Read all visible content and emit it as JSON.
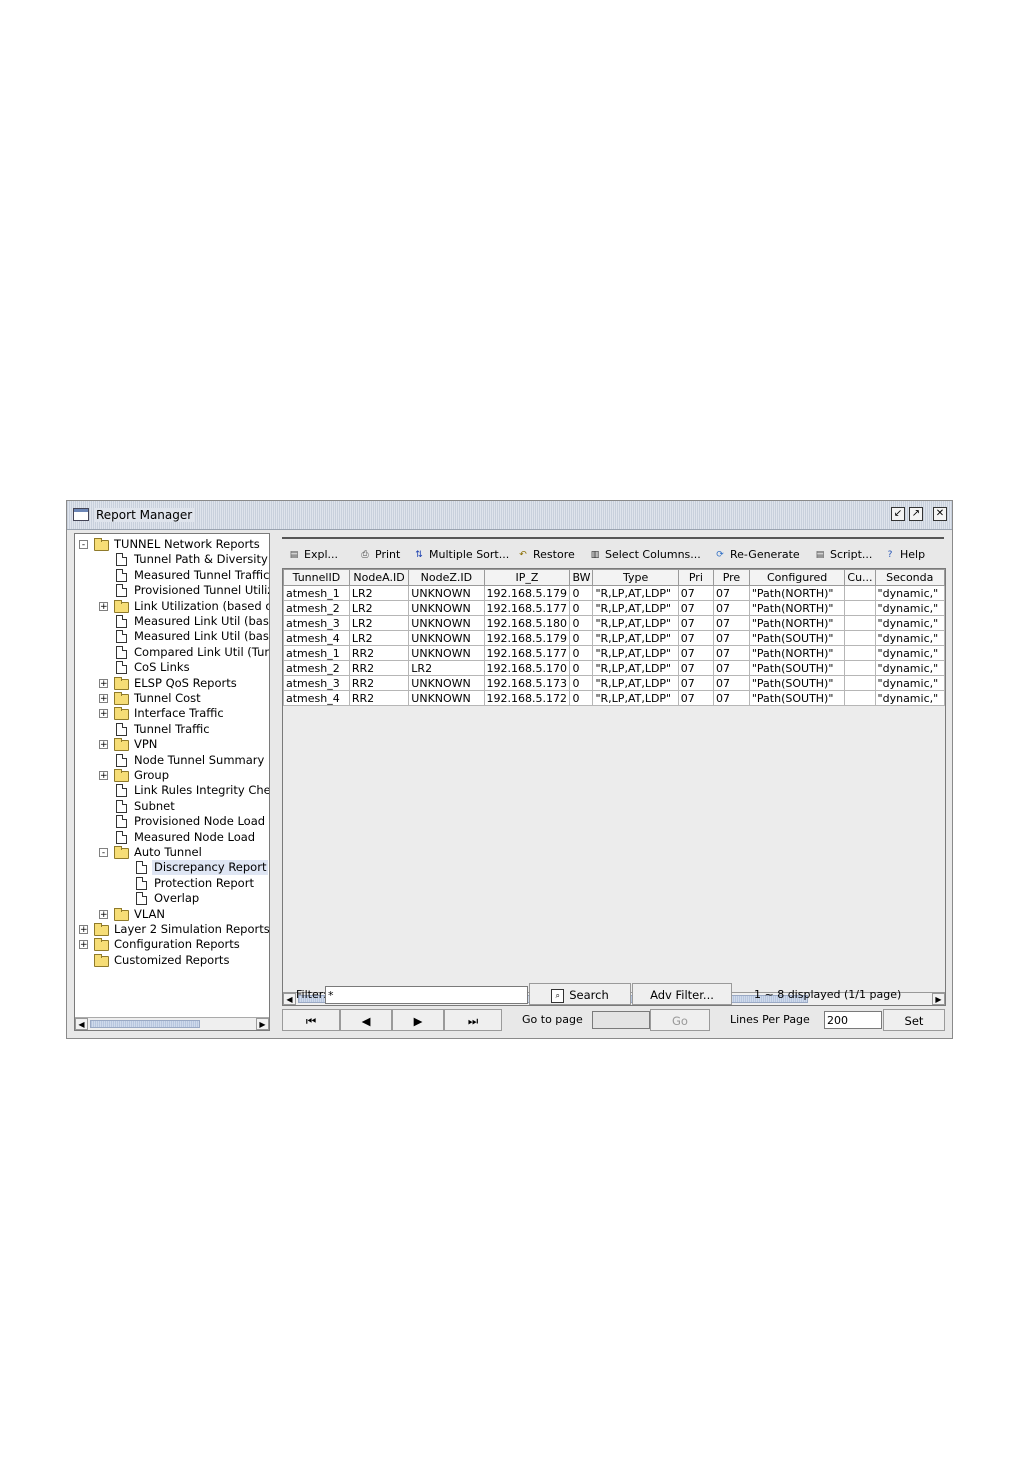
{
  "window": {
    "title": "Report Manager"
  },
  "tree": [
    {
      "label": "TUNNEL Network Reports",
      "type": "folder",
      "level": 0,
      "toggle": "-"
    },
    {
      "label": "Tunnel Path & Diversity",
      "type": "doc",
      "level": 1
    },
    {
      "label": "Measured Tunnel Traffic",
      "type": "doc",
      "level": 1
    },
    {
      "label": "Provisioned Tunnel Utiliza",
      "type": "doc",
      "level": 1
    },
    {
      "label": "Link Utilization (based on",
      "type": "folder",
      "level": 1,
      "toggle": "+"
    },
    {
      "label": "Measured Link Util (based",
      "type": "doc",
      "level": 1
    },
    {
      "label": "Measured Link Util (based",
      "type": "doc",
      "level": 1
    },
    {
      "label": "Compared Link Util (Tunn",
      "type": "doc",
      "level": 1
    },
    {
      "label": "CoS Links",
      "type": "doc",
      "level": 1
    },
    {
      "label": "ELSP QoS Reports",
      "type": "folder",
      "level": 1,
      "toggle": "+"
    },
    {
      "label": "Tunnel Cost",
      "type": "folder",
      "level": 1,
      "toggle": "+"
    },
    {
      "label": "Interface Traffic",
      "type": "folder",
      "level": 1,
      "toggle": "+"
    },
    {
      "label": "Tunnel Traffic",
      "type": "doc",
      "level": 1
    },
    {
      "label": "VPN",
      "type": "folder",
      "level": 1,
      "toggle": "+"
    },
    {
      "label": "Node Tunnel Summary",
      "type": "doc",
      "level": 1
    },
    {
      "label": "Group",
      "type": "folder",
      "level": 1,
      "toggle": "+"
    },
    {
      "label": "Link Rules Integrity Check",
      "type": "doc",
      "level": 1
    },
    {
      "label": "Subnet",
      "type": "doc",
      "level": 1
    },
    {
      "label": "Provisioned Node Load",
      "type": "doc",
      "level": 1
    },
    {
      "label": "Measured Node Load",
      "type": "doc",
      "level": 1
    },
    {
      "label": "Auto Tunnel",
      "type": "folder",
      "level": 1,
      "toggle": "-"
    },
    {
      "label": "Discrepancy Report",
      "type": "doc",
      "level": 2,
      "selected": true
    },
    {
      "label": "Protection Report",
      "type": "doc",
      "level": 2
    },
    {
      "label": "Overlap",
      "type": "doc",
      "level": 2
    },
    {
      "label": "VLAN",
      "type": "folder",
      "level": 1,
      "toggle": "+"
    },
    {
      "label": "Layer 2 Simulation Reports",
      "type": "folder",
      "level": 0,
      "toggle": "+"
    },
    {
      "label": "Configuration Reports",
      "type": "folder",
      "level": 0,
      "toggle": "+"
    },
    {
      "label": "Customized Reports",
      "type": "folder",
      "level": 0
    }
  ],
  "toolbar": [
    {
      "label": "Expl...",
      "icon": "document-icon",
      "glyph": "▤",
      "color": "#444444"
    },
    {
      "label": "Print",
      "icon": "printer-icon",
      "glyph": "⎙",
      "color": "#444444"
    },
    {
      "label": "Multiple Sort...",
      "icon": "sort-icon",
      "glyph": "⇅",
      "color": "#1a3fb0"
    },
    {
      "label": "Restore",
      "icon": "restore-icon",
      "glyph": "↶",
      "color": "#8a6d00"
    },
    {
      "label": "Select Columns...",
      "icon": "columns-icon",
      "glyph": "▥",
      "color": "#222222"
    },
    {
      "label": "Re-Generate",
      "icon": "refresh-icon",
      "glyph": "⟳",
      "color": "#2b6cc4"
    },
    {
      "label": "Script...",
      "icon": "script-icon",
      "glyph": "▤",
      "color": "#444444"
    },
    {
      "label": "Help",
      "icon": "help-icon",
      "glyph": "?",
      "color": "#2152b5"
    }
  ],
  "table": {
    "columns": [
      "TunnelID",
      "NodeA.ID",
      "NodeZ.ID",
      "IP_Z",
      "BW",
      "Type",
      "Pri",
      "Pre",
      "Configured",
      "Cu...",
      "Seconda"
    ],
    "rows": [
      [
        "atmesh_1",
        "LR2",
        "UNKNOWN",
        "192.168.5.179",
        "0",
        "\"R,LP,AT,LDP\"",
        "07",
        "07",
        "\"Path(NORTH)\"",
        "",
        "\"dynamic,\""
      ],
      [
        "atmesh_2",
        "LR2",
        "UNKNOWN",
        "192.168.5.177",
        "0",
        "\"R,LP,AT,LDP\"",
        "07",
        "07",
        "\"Path(NORTH)\"",
        "",
        "\"dynamic,\""
      ],
      [
        "atmesh_3",
        "LR2",
        "UNKNOWN",
        "192.168.5.180",
        "0",
        "\"R,LP,AT,LDP\"",
        "07",
        "07",
        "\"Path(NORTH)\"",
        "",
        "\"dynamic,\""
      ],
      [
        "atmesh_4",
        "LR2",
        "UNKNOWN",
        "192.168.5.179",
        "0",
        "\"R,LP,AT,LDP\"",
        "07",
        "07",
        "\"Path(SOUTH)\"",
        "",
        "\"dynamic,\""
      ],
      [
        "atmesh_1",
        "RR2",
        "UNKNOWN",
        "192.168.5.177",
        "0",
        "\"R,LP,AT,LDP\"",
        "07",
        "07",
        "\"Path(NORTH)\"",
        "",
        "\"dynamic,\""
      ],
      [
        "atmesh_2",
        "RR2",
        "LR2",
        "192.168.5.170",
        "0",
        "\"R,LP,AT,LDP\"",
        "07",
        "07",
        "\"Path(SOUTH)\"",
        "",
        "\"dynamic,\""
      ],
      [
        "atmesh_3",
        "RR2",
        "UNKNOWN",
        "192.168.5.173",
        "0",
        "\"R,LP,AT,LDP\"",
        "07",
        "07",
        "\"Path(SOUTH)\"",
        "",
        "\"dynamic,\""
      ],
      [
        "atmesh_4",
        "RR2",
        "UNKNOWN",
        "192.168.5.172",
        "0",
        "\"R,LP,AT,LDP\"",
        "07",
        "07",
        "\"Path(SOUTH)\"",
        "",
        "\"dynamic,\""
      ]
    ]
  },
  "filter": {
    "label": "Filter:",
    "value": "*",
    "search_label": "Search",
    "adv_label": "Adv Filter...",
    "status": "1 ~ 8 displayed (1/1 page)"
  },
  "pager": {
    "first": "⏮",
    "prev": "◀",
    "next": "▶",
    "last": "⏭",
    "goto_label": "Go to page",
    "go_label": "Go",
    "lines_label": "Lines Per Page",
    "lines_value": "200",
    "set_label": "Set"
  }
}
